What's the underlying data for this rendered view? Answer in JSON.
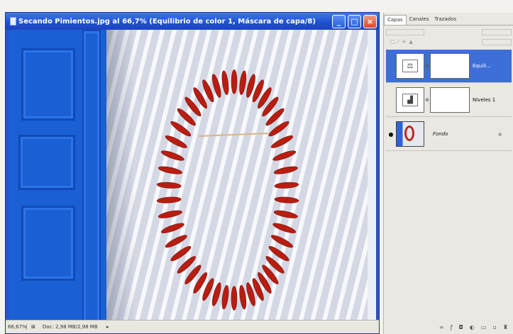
{
  "document": {
    "title": "Secando Pimientos.jpg al 66,7% (Equilibrio de color 1, Máscara de capa/8)",
    "window_buttons": {
      "minimize": "_",
      "maximize": "□",
      "close": "×"
    },
    "status": {
      "zoom": "66,67%",
      "doc_info": "Doc: 2,98 MB/2,98 MB",
      "arrow": "▸"
    }
  },
  "layers_panel": {
    "tabs": [
      "Capas",
      "Canales",
      "Trazados"
    ],
    "active_tab": "Capas",
    "lock_icons": "□ ⁄ ✛ ▲",
    "layers": [
      {
        "name": "Equili...",
        "selected": true,
        "thumb_icon": "balance-icon",
        "link": "⊗"
      },
      {
        "name": "Niveles 1",
        "selected": false,
        "thumb_icon": "histogram-icon",
        "link": "⊗"
      },
      {
        "name": "Fondo",
        "selected": false,
        "visible": true,
        "eye": "●",
        "lock": "⌂"
      }
    ],
    "footer_icons": [
      "link-icon",
      "fx-icon",
      "mask-icon",
      "adjustment-icon",
      "folder-icon",
      "new-layer-icon",
      "trash-icon"
    ],
    "footer_glyphs": [
      "∞",
      "ƒ",
      "◘",
      "◐",
      "▭",
      "▫",
      "♜"
    ]
  },
  "colors": {
    "title_bar": "#1f4fd0",
    "selection": "#3e6fd8",
    "door": "#1b5fd4",
    "pepper": "#c1271b"
  }
}
